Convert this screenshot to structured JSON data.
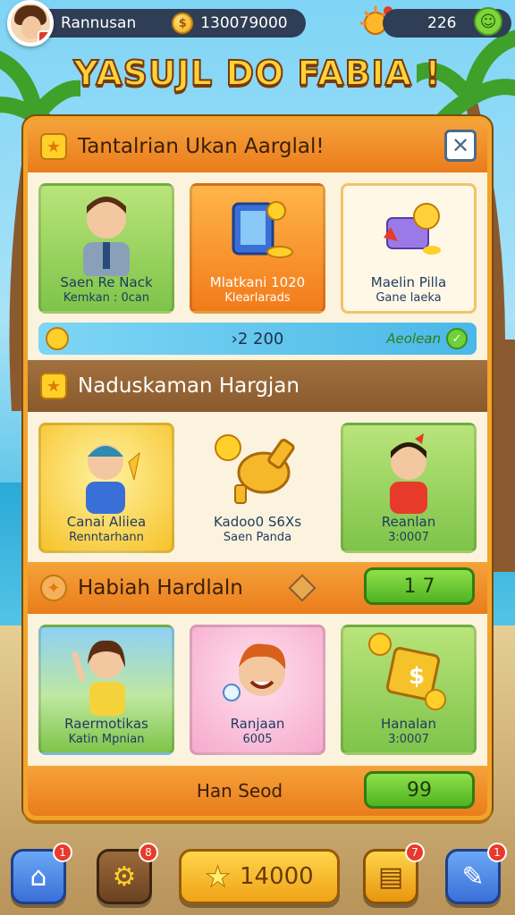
{
  "top_bar": {
    "player_name": "Rannusan",
    "coins": "130079000",
    "energy": "226"
  },
  "title": "YASUJL DO FABIA !",
  "panel": {
    "section1": {
      "title": "Tantalrian Ukan Aarglal!",
      "cards": [
        {
          "line1": "Saen Re Nack",
          "line2": "Kemkan : 0can"
        },
        {
          "line1": "Mlatkani 1020",
          "line2": "Klearlarads"
        },
        {
          "line1": "Maelin Pilla",
          "line2": "Gane laeka"
        }
      ],
      "strip_value": "›2 200",
      "strip_action": "Aeolean"
    },
    "section2": {
      "title": "Naduskaman Hargjan",
      "cards": [
        {
          "line1": "Canai Aliiea",
          "line2": "Renntarhann"
        },
        {
          "line1": "Kadoo0 S6Xs",
          "line2": "Saen Panda"
        },
        {
          "line1": "Reanlan",
          "line2": "3:0007"
        }
      ]
    },
    "section3": {
      "title": "Habiah Hardlaln",
      "counter": "1 7",
      "cards": [
        {
          "line1": "Raermotikas",
          "line2": "Katin Mpnian"
        },
        {
          "line1": "Ranjaan",
          "line2": "6005"
        },
        {
          "line1": "Hanalan",
          "line2": "3:0007"
        }
      ]
    },
    "footer": {
      "label": "Han Seod",
      "counter": "99"
    }
  },
  "bottom_nav": {
    "home_badge": "1",
    "settings_badge": "8",
    "score": "14000",
    "chest_badge": "7",
    "edit_badge": "1"
  }
}
